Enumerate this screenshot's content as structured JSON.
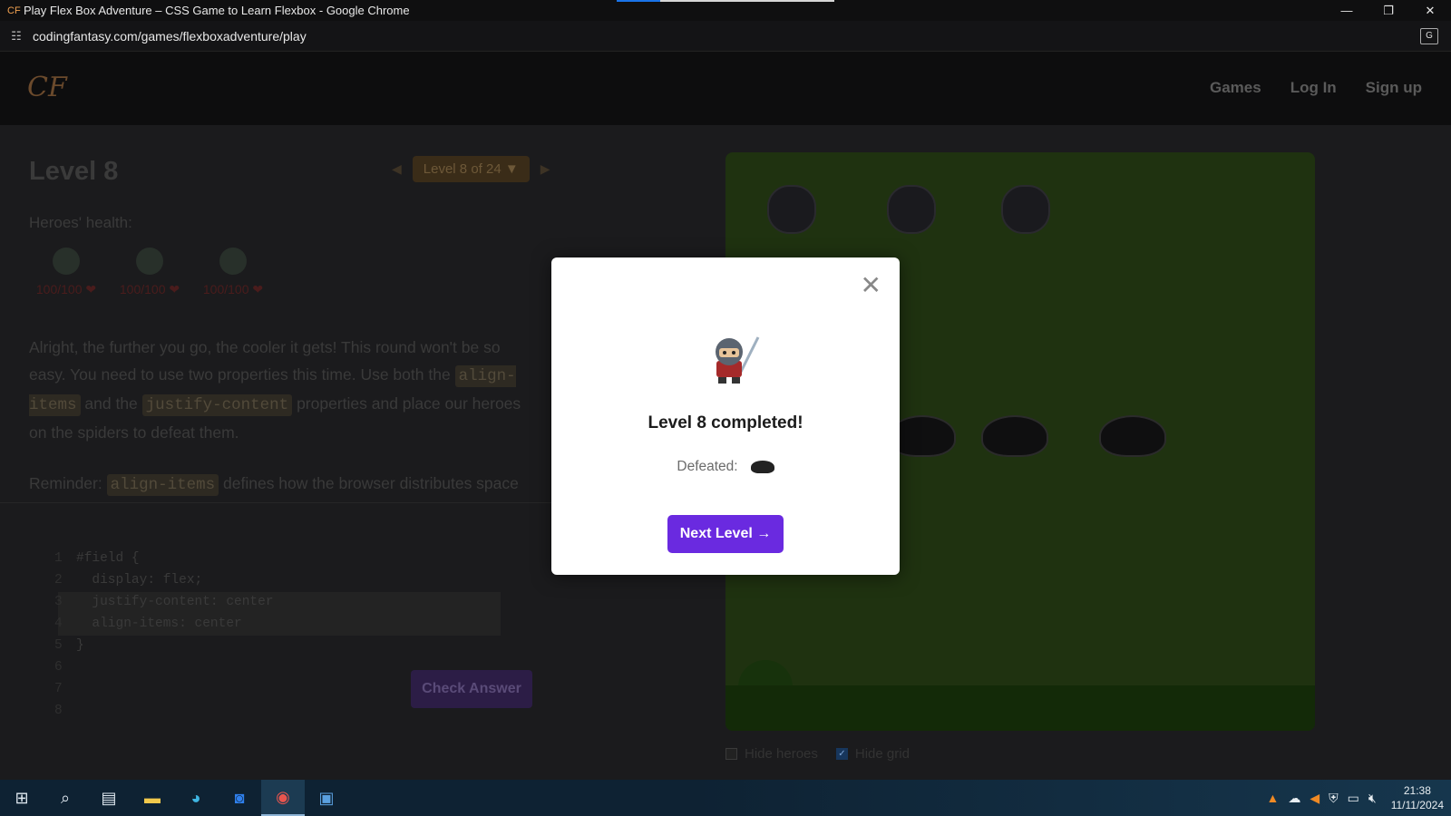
{
  "browser": {
    "window_title": "Play Flex Box Adventure – CSS Game to Learn Flexbox - Google Chrome",
    "url": "codingfantasy.com/games/flexboxadventure/play",
    "controls": {
      "minimize": "—",
      "restore": "❐",
      "close": "✕"
    }
  },
  "site": {
    "logo": "CF",
    "nav": [
      "Games",
      "Log In",
      "Sign up"
    ]
  },
  "level": {
    "title": "Level 8",
    "selector": "Level 8 of 24 ▼",
    "prev": "◀",
    "next": "▶",
    "health_label": "Heroes' health:",
    "heroes": [
      {
        "hp": "100/100 ❤"
      },
      {
        "hp": "100/100 ❤"
      },
      {
        "hp": "100/100 ❤"
      }
    ],
    "story_1": "Alright, the further you go, the cooler it gets! This round won't be so easy. You need to use two properties this time. Use both the",
    "kw_align": "align-items",
    "and_the": "and the",
    "kw_justify": "justify-content",
    "story_2": "properties and place our heroes on the spiders to defeat them.",
    "reminder_pre": "Reminder:",
    "reminder_kw": "align-items",
    "reminder_post": "defines how the browser distributes space"
  },
  "editor": {
    "lines": [
      {
        "n": "1",
        "text": "#field {"
      },
      {
        "n": "2",
        "text": "  display: flex;"
      },
      {
        "n": "3",
        "text": "  justify-content: center"
      },
      {
        "n": "4",
        "text": "  align-items: center"
      },
      {
        "n": "5",
        "text": "}"
      },
      {
        "n": "6",
        "text": ""
      },
      {
        "n": "7",
        "text": ""
      },
      {
        "n": "8",
        "text": ""
      }
    ],
    "check_button": "Check Answer"
  },
  "field": {
    "toggles": [
      {
        "label": "Hide heroes",
        "checked": false
      },
      {
        "label": "Hide grid",
        "checked": true
      }
    ]
  },
  "modal": {
    "close": "✕",
    "heading": "Level 8 completed!",
    "defeated_label": "Defeated:",
    "next_button": "Next Level →"
  },
  "taskbar": {
    "apps": [
      {
        "name": "start",
        "icon": "windows-icon"
      },
      {
        "name": "search",
        "icon": "search-icon"
      },
      {
        "name": "task-view",
        "icon": "task-view-icon"
      },
      {
        "name": "file-explorer",
        "icon": "folder-icon"
      },
      {
        "name": "edge",
        "icon": "edge-icon"
      },
      {
        "name": "outlook",
        "icon": "outlook-icon"
      },
      {
        "name": "chrome",
        "icon": "chrome-icon",
        "active": true
      },
      {
        "name": "app",
        "icon": "window-icon"
      }
    ],
    "time": "21:38",
    "date": "11/11/2024"
  }
}
